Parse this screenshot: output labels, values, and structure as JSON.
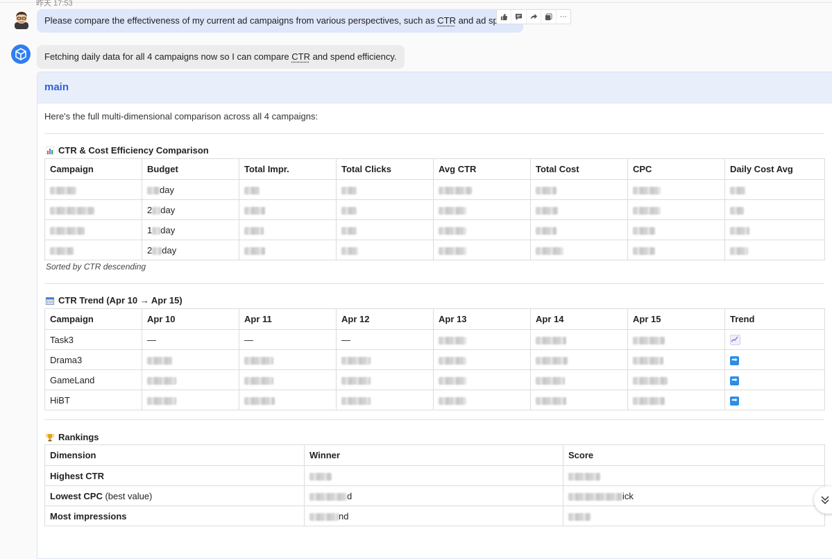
{
  "timestamp": "昨天 17:53",
  "user_message": {
    "text_before": "Please compare the effectiveness of my current ad campaigns from various perspectives, such as ",
    "text_ctr": "CTR",
    "text_after": " and ad spend."
  },
  "message_actions": [
    "thumb-up-icon",
    "comment-icon",
    "share-icon",
    "copy-icon",
    "more-icon"
  ],
  "bot_status": {
    "text_before": "Fetching daily data for all 4 campaigns now so I can compare ",
    "text_ctr": "CTR",
    "text_after": " and spend efficiency."
  },
  "card": {
    "title": "main",
    "intro": "Here's the full multi-dimensional comparison across all 4 campaigns:"
  },
  "efficiency_section": {
    "title": "CTR & Cost Efficiency Comparison",
    "icon": "bar-chart-icon",
    "headers": [
      "Campaign",
      "Budget",
      "Total Impr.",
      "Total Clicks",
      "Avg CTR",
      "Total Cost",
      "CPC",
      "Daily Cost Avg"
    ],
    "budget_prefixes": [
      "",
      "2",
      "1",
      "2"
    ],
    "budget_suffix": "day",
    "note": "Sorted by CTR descending"
  },
  "trend_section": {
    "title": "CTR Trend (Apr 10 → Apr 15)",
    "icon": "calendar-icon",
    "headers": [
      "Campaign",
      "Apr 10",
      "Apr 11",
      "Apr 12",
      "Apr 13",
      "Apr 14",
      "Apr 15",
      "Trend"
    ],
    "campaigns": [
      "Task3",
      "Drama3",
      "GameLand",
      "HiBT"
    ],
    "dash": "—",
    "trend_icons": [
      "chart-increasing-icon",
      "right-arrow-icon",
      "right-arrow-icon",
      "right-arrow-icon"
    ]
  },
  "rankings_section": {
    "title": "Rankings",
    "icon": "trophy-icon",
    "headers": [
      "Dimension",
      "Winner",
      "Score"
    ],
    "rows": [
      {
        "dimension": "Highest CTR",
        "qualifier": "",
        "winner_suffix": "",
        "score_suffix": ""
      },
      {
        "dimension": "Lowest CPC",
        "qualifier": " (best value)",
        "winner_suffix": "d",
        "score_suffix": "ick"
      },
      {
        "dimension": "Most impressions",
        "qualifier": "",
        "winner_suffix": "nd",
        "score_suffix": ""
      }
    ]
  },
  "colors": {
    "user_bubble": "#dfe7fb",
    "bot_avatar": "#2f7ff0",
    "card_header": "#e9eefb",
    "card_title": "#2d62d9",
    "trend_arrow": "#2d8de6"
  }
}
